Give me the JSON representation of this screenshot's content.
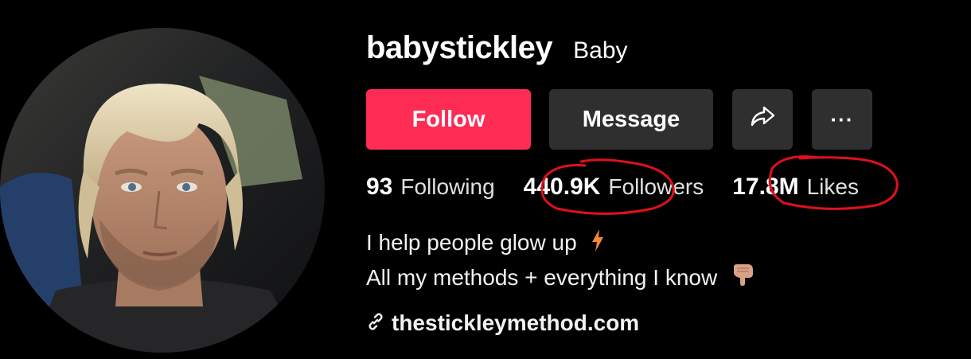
{
  "profile": {
    "username": "babystickley",
    "nickname": "Baby"
  },
  "actions": {
    "follow_label": "Follow",
    "message_label": "Message",
    "share_icon": "share-arrow-icon",
    "more_label": "···"
  },
  "stats": {
    "following_count": "93",
    "following_label": "Following",
    "followers_count": "440.9K",
    "followers_label": "Followers",
    "likes_count": "17.8M",
    "likes_label": "Likes"
  },
  "bio": {
    "line1": "I help people glow up",
    "line1_emoji": "lightning-icon",
    "line2": "All my methods + everything I know",
    "line2_emoji": "pointing-down-icon"
  },
  "link": {
    "icon": "link-icon",
    "text": "thestickleymethod.com"
  },
  "colors": {
    "background": "#000000",
    "follow": "#fe2c55",
    "secondary_button": "#2f2f2f",
    "annotation": "#e0101a"
  }
}
